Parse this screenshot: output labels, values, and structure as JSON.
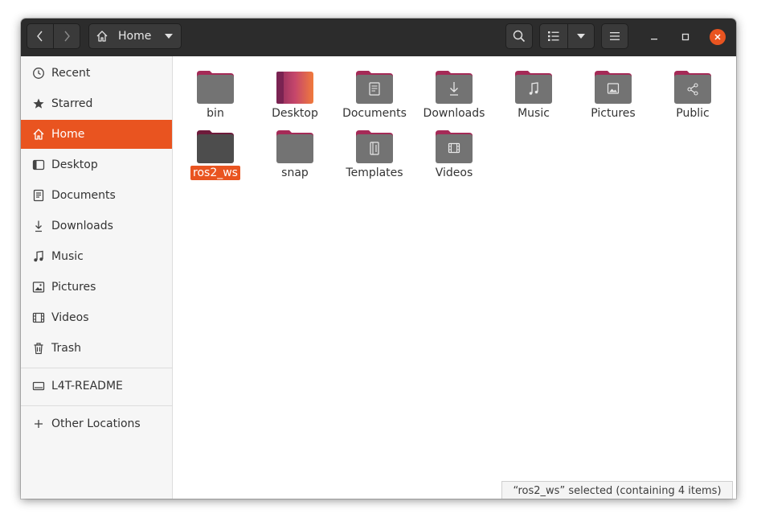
{
  "header": {
    "location_label": "Home",
    "back_icon": "chevron-left-icon",
    "forward_icon": "chevron-right-icon",
    "search_icon": "search-icon",
    "view_icon": "list-view-icon",
    "menu_icon": "hamburger-menu-icon"
  },
  "sidebar": {
    "items": [
      {
        "label": "Recent",
        "icon": "clock-icon"
      },
      {
        "label": "Starred",
        "icon": "star-icon"
      },
      {
        "label": "Home",
        "icon": "home-icon",
        "active": true
      },
      {
        "label": "Desktop",
        "icon": "desktop-icon"
      },
      {
        "label": "Documents",
        "icon": "document-icon"
      },
      {
        "label": "Downloads",
        "icon": "download-icon"
      },
      {
        "label": "Music",
        "icon": "music-icon"
      },
      {
        "label": "Pictures",
        "icon": "picture-icon"
      },
      {
        "label": "Videos",
        "icon": "video-icon"
      },
      {
        "label": "Trash",
        "icon": "trash-icon"
      }
    ],
    "devices": [
      {
        "label": "L4T-README",
        "icon": "drive-icon"
      }
    ],
    "other": [
      {
        "label": "Other Locations",
        "icon": "plus-icon"
      }
    ]
  },
  "files": [
    {
      "name": "bin",
      "emblem": "none"
    },
    {
      "name": "Desktop",
      "emblem": "desktop"
    },
    {
      "name": "Documents",
      "emblem": "document"
    },
    {
      "name": "Downloads",
      "emblem": "download"
    },
    {
      "name": "Music",
      "emblem": "music"
    },
    {
      "name": "Pictures",
      "emblem": "picture"
    },
    {
      "name": "Public",
      "emblem": "share"
    },
    {
      "name": "ros2_ws",
      "emblem": "none",
      "selected": true
    },
    {
      "name": "snap",
      "emblem": "none"
    },
    {
      "name": "Templates",
      "emblem": "template"
    },
    {
      "name": "Videos",
      "emblem": "video"
    }
  ],
  "status": {
    "text": "“ros2_ws” selected  (containing 4 items)"
  },
  "colors": {
    "accent": "#e95420",
    "headerbar": "#2c2c2c",
    "folder_body": "#737373",
    "folder_tab": "#a52a57"
  }
}
